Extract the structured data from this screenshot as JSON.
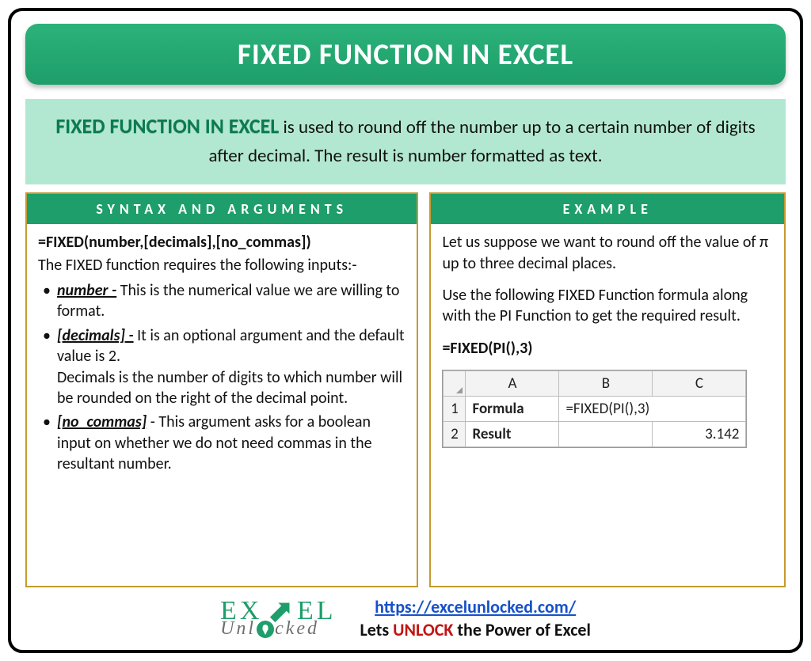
{
  "title": "FIXED FUNCTION IN EXCEL",
  "intro": {
    "lead": "FIXED FUNCTION IN EXCEL",
    "rest": " is used to round off the number up to a certain number of digits after decimal. The result is number formatted as text."
  },
  "left": {
    "header": "SYNTAX AND ARGUMENTS",
    "syntax": "=FIXED(number,[decimals],[no_commas])",
    "requires": "The FIXED function requires the following inputs:-",
    "args": [
      {
        "name": "number -",
        "desc": " This is the numerical value we are willing to format."
      },
      {
        "name": "[decimals] -",
        "desc": " It is an optional argument and the default value is 2.",
        "desc2": "Decimals is the number of digits to which number will be rounded on the right of the decimal point."
      },
      {
        "name": "[no_commas]",
        "desc": " - This argument asks for a boolean input on whether we do not need commas in the resultant number."
      }
    ]
  },
  "right": {
    "header": "EXAMPLE",
    "p1": "Let us suppose we want to round off the value of π up to three decimal places.",
    "p2": "Use the following FIXED Function formula along with the PI Function to get the required result.",
    "formula": "=FIXED(PI(),3)",
    "table": {
      "cols": [
        "A",
        "B",
        "C"
      ],
      "rows": [
        {
          "n": "1",
          "a": "Formula",
          "b": "=FIXED(PI(),3)",
          "c": ""
        },
        {
          "n": "2",
          "a": "Result",
          "b": "",
          "c": "3.142"
        }
      ]
    }
  },
  "footer": {
    "logo": {
      "row1a": "EX",
      "row1b": "EL",
      "row2a": "Unl",
      "row2b": "cked"
    },
    "url": "https://excelunlocked.com/",
    "tag_pre": "Lets ",
    "tag_unlock": "UNLOCK",
    "tag_post": " the Power of Excel"
  }
}
